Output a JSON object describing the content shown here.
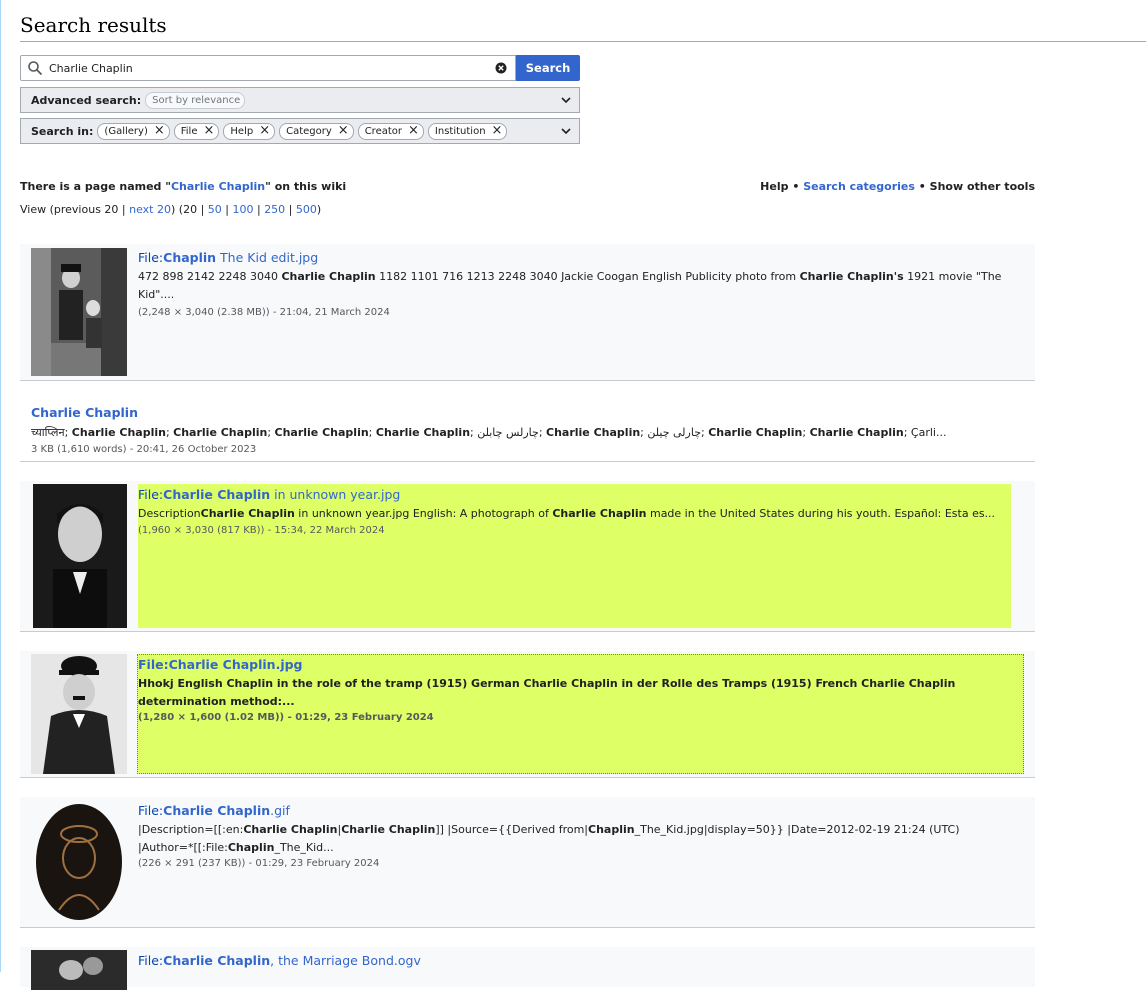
{
  "page_title": "Search results",
  "search": {
    "value": "Charlie Chaplin",
    "button": "Search"
  },
  "advanced": {
    "label": "Advanced search:",
    "sort": "Sort by relevance"
  },
  "search_in": {
    "label": "Search in:",
    "chips": [
      "(Gallery)",
      "File",
      "Help",
      "Category",
      "Creator",
      "Institution"
    ]
  },
  "info": {
    "prefix": "There is a page named \"",
    "link": "Charlie Chaplin",
    "suffix": "\" on this wiki"
  },
  "tools": {
    "help": "Help",
    "sep": "•",
    "categories": "Search categories",
    "other": "Show other tools"
  },
  "view": {
    "pre": "View (previous 20 | ",
    "next": "next 20",
    "mid": ") (20 | ",
    "l50": "50",
    "l100": "100",
    "l250": "250",
    "l500": "500",
    "sep": " | ",
    "close": ")"
  },
  "results": [
    {
      "title_pre": "File:",
      "title_b": "Chaplin",
      "title_post": " The Kid edit.jpg",
      "snippet_html": "472 898 2142 2248 3040 <b>Charlie Chaplin</b> 1182 1101 716 1213 2248 3040 Jackie Coogan English Publicity photo from <b>Charlie Chaplin's</b> 1921 movie \"The Kid\"....",
      "meta": "(2,248 × 3,040 (2.38 MB)) - 21:04, 21 March 2024"
    },
    {
      "title": "Charlie Chaplin",
      "snippet_html": "च्याप्लिन; <b>Charlie Chaplin</b>; <b>Charlie Chaplin</b>; <b>Charlie Chaplin</b>; <b>Charlie Chaplin</b>; چارلس چابلن; <b>Charlie Chaplin</b>; چارلی چیلن; <b>Charlie Chaplin</b>; <b>Charlie Chaplin</b>; Çarli...",
      "meta": "3 KB (1,610 words) - 20:41, 26 October 2023"
    },
    {
      "title_pre": "File:",
      "title_b": "Charlie Chaplin",
      "title_post": " in unknown year.jpg",
      "snippet_html": "Description<b>Charlie Chaplin</b> in unknown year.jpg English: A photograph of <b>Charlie Chaplin</b> made in the United States during his youth. Español: Esta es...",
      "meta": "(1,960 × 3,030 (817 KB)) - 15:34, 22 March 2024"
    },
    {
      "title": "File:Charlie Chaplin.jpg",
      "snippet_html": "Hhokj English Chaplin in the role of the tramp (1915) German Charlie Chaplin in der Rolle des Tramps (1915) French Charlie Chaplin determination method:...",
      "meta": "(1,280 × 1,600 (1.02 MB)) - 01:29, 23 February 2024"
    },
    {
      "title_pre": "File:",
      "title_b": "Charlie Chaplin",
      "title_post": ".gif",
      "snippet_html": "|Description=[[:en:<b>Charlie Chaplin</b>|<b>Charlie Chaplin</b>]] |Source={{Derived from|<b>Chaplin</b>_The_Kid.jpg|display=50}} |Date=2012-02-19 21:24 (UTC) |Author=*[[:File:<b>Chaplin</b>_The_Kid...",
      "meta": "(226 × 291 (237 KB)) - 01:29, 23 February 2024"
    },
    {
      "title_pre": "File:",
      "title_b": "Charlie Chaplin",
      "title_post": ", the Marriage Bond.ogv"
    }
  ]
}
